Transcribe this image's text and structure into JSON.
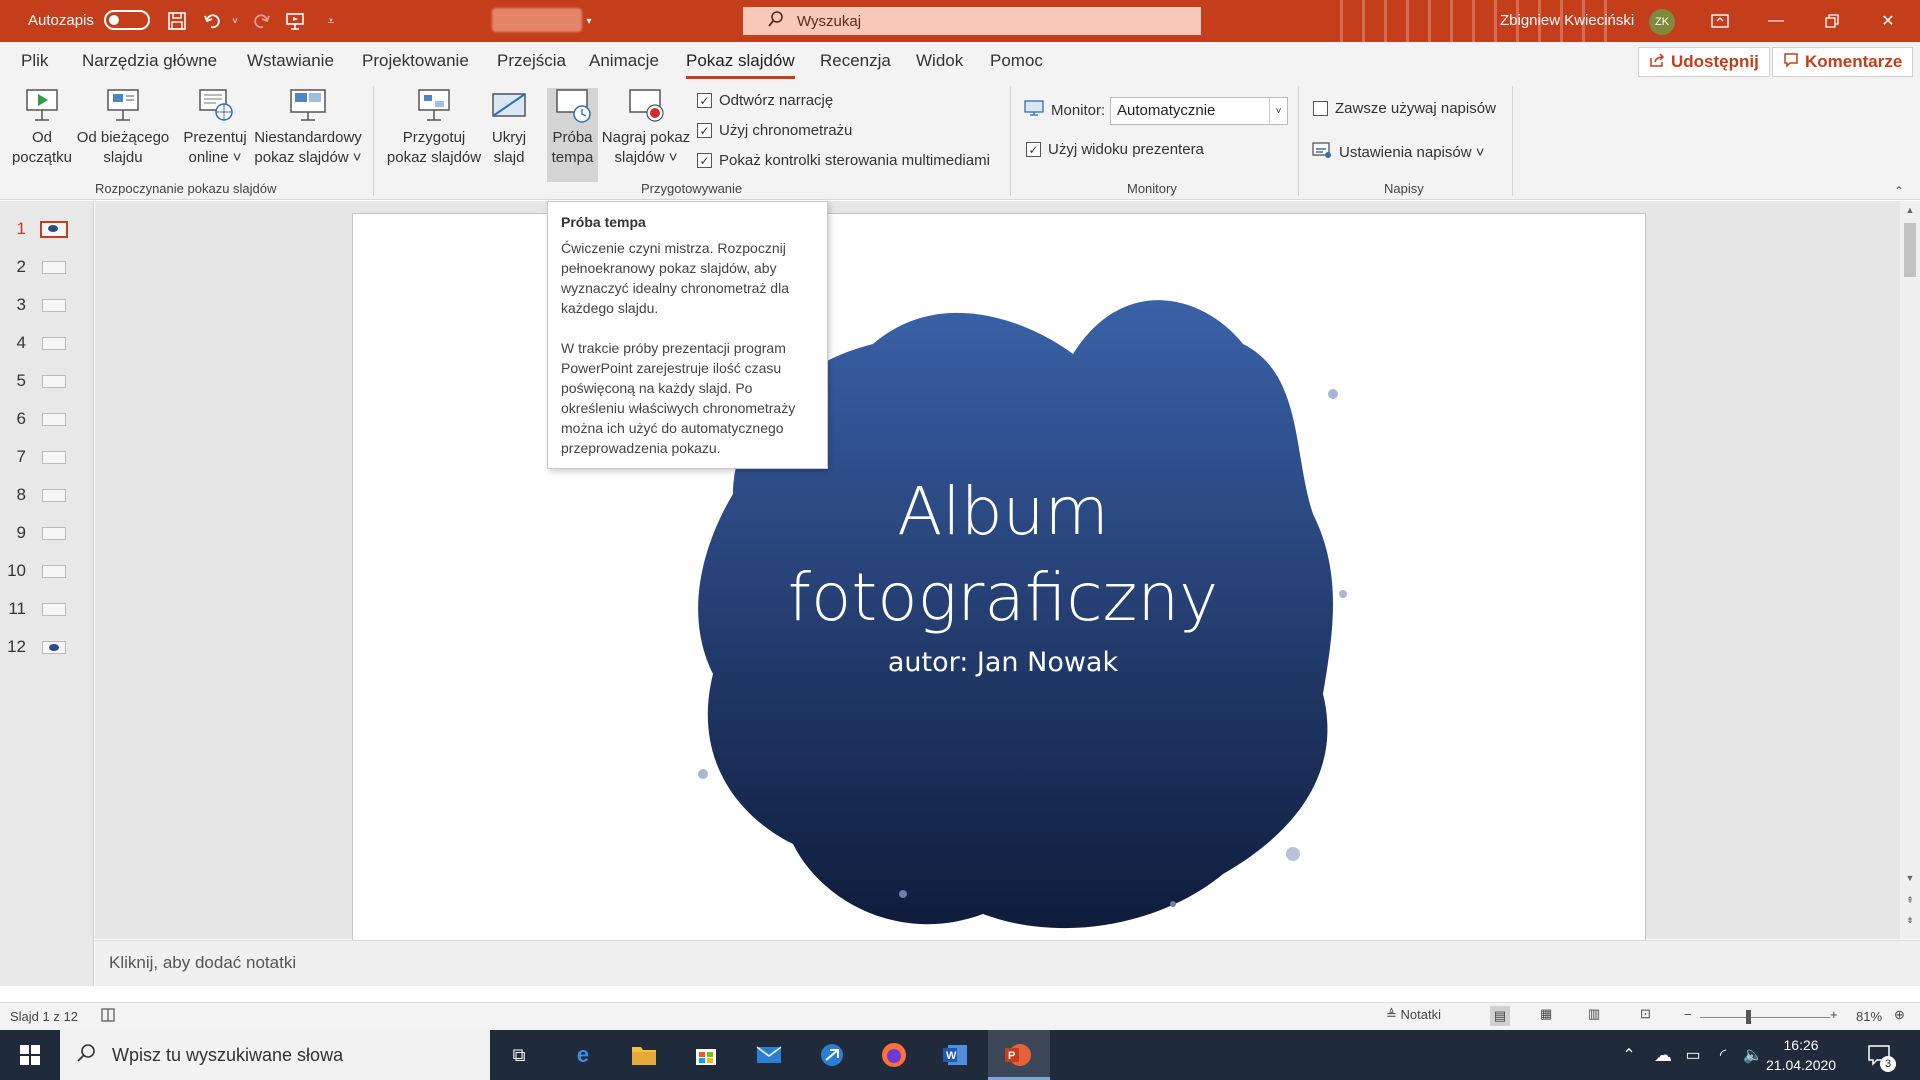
{
  "titlebar": {
    "autosave_label": "Autozapis",
    "search_placeholder": "Wyszukaj",
    "user_name": "Zbigniew Kwieciński",
    "user_initials": "ZK"
  },
  "menu": {
    "tabs": [
      "Plik",
      "Narzędzia główne",
      "Wstawianie",
      "Projektowanie",
      "Przejścia",
      "Animacje",
      "Pokaz slajdów",
      "Recenzja",
      "Widok",
      "Pomoc"
    ],
    "active_tab": "Pokaz slajdów",
    "share_label": "Udostępnij",
    "comments_label": "Komentarze"
  },
  "ribbon": {
    "start_group": {
      "label": "Rozpoczynanie pokazu slajdów",
      "buttons": [
        {
          "line1": "Od",
          "line2": "początku"
        },
        {
          "line1": "Od bieżącego",
          "line2": "slajdu"
        },
        {
          "line1": "Prezentuj",
          "line2": "online ˅"
        },
        {
          "line1": "Niestandardowy",
          "line2": "pokaz slajdów ˅"
        }
      ]
    },
    "setup_group": {
      "label": "Przygotowywanie",
      "buttons": [
        {
          "line1": "Przygotuj",
          "line2": "pokaz slajdów"
        },
        {
          "line1": "Ukryj",
          "line2": "slajd"
        },
        {
          "line1": "Próba",
          "line2": "tempa"
        },
        {
          "line1": "Nagraj pokaz",
          "line2": "slajdów ˅"
        }
      ],
      "checkboxes": [
        {
          "label": "Odtwórz narrację",
          "checked": true
        },
        {
          "label": "Użyj chronometrażu",
          "checked": true
        },
        {
          "label": "Pokaż kontrolki sterowania multimediami",
          "checked": true
        }
      ]
    },
    "monitors_group": {
      "label": "Monitory",
      "monitor_label": "Monitor:",
      "monitor_value": "Automatycznie",
      "presenter_view_label": "Użyj widoku prezentera",
      "presenter_view_checked": true
    },
    "captions_group": {
      "label": "Napisy",
      "always_captions_label": "Zawsze używaj napisów",
      "always_captions_checked": false,
      "caption_settings_label": "Ustawienia napisów ˅"
    }
  },
  "tooltip": {
    "title": "Próba tempa",
    "paragraph1": "Ćwiczenie czyni mistrza. Rozpocznij pełnoekranowy pokaz slajdów, aby wyznaczyć idealny chronometraż dla każdego slajdu.",
    "paragraph2": "W trakcie próby prezentacji program PowerPoint zarejestruje ilość czasu poświęconą na każdy slajd. Po określeniu właściwych chronometraży można ich użyć do automatycznego przeprowadzenia pokazu."
  },
  "thumbnails": {
    "numbers": [
      "1",
      "2",
      "3",
      "4",
      "5",
      "6",
      "7",
      "8",
      "9",
      "10",
      "11",
      "12"
    ],
    "active_index": 0
  },
  "slide": {
    "title_line1": "Album",
    "title_line2": "fotograficzny",
    "subtitle": "autor: Jan Nowak",
    "splash_color": "#2b4a86"
  },
  "notes_placeholder": "Kliknij, aby dodać notatki",
  "status": {
    "slide_counter": "Slajd 1 z 12",
    "notes_label": "Notatki",
    "zoom_minus": "−",
    "zoom_plus": "+",
    "zoom_level": "81%"
  },
  "taskbar": {
    "search_placeholder": "Wpisz tu wyszukiwane słowa",
    "time": "16:26",
    "date": "21.04.2020",
    "notification_count": "3"
  },
  "colors": {
    "accent": "#c43e1c",
    "taskbar": "#1f2b3a"
  }
}
